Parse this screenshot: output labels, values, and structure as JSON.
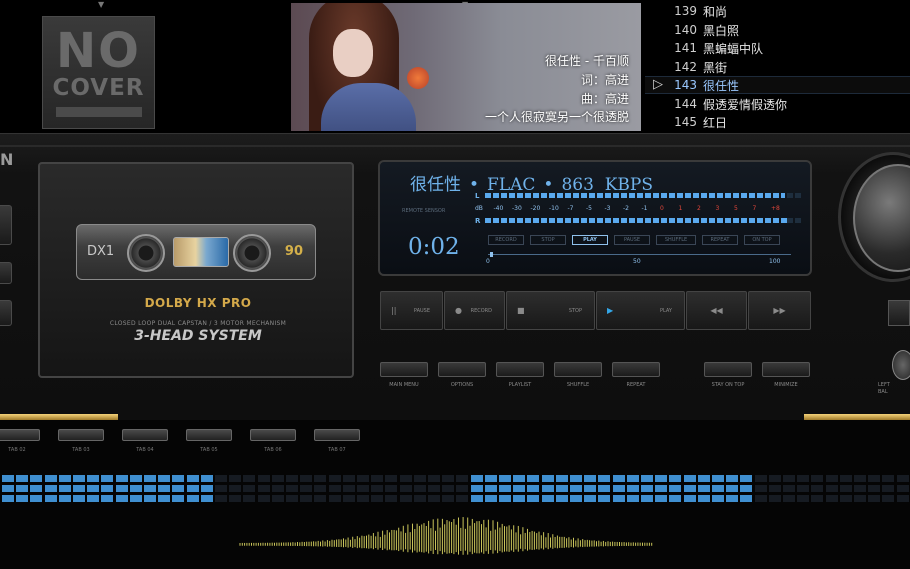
{
  "top": {
    "no_cover": {
      "line1": "NO",
      "line2": "COVER"
    },
    "lyrics": [
      "很任性 - 千百顺",
      "词：高进",
      "曲：高进",
      "一个人很寂寞另一个很透脱"
    ]
  },
  "playlist": {
    "items": [
      {
        "num": "139",
        "title": "和尚"
      },
      {
        "num": "140",
        "title": "黑白照"
      },
      {
        "num": "141",
        "title": "黑蝙蝠中队"
      },
      {
        "num": "142",
        "title": "黑街"
      },
      {
        "num": "143",
        "title": "很任性",
        "selected": true
      },
      {
        "num": "144",
        "title": "假透爱情假透你"
      },
      {
        "num": "145",
        "title": "红日"
      }
    ],
    "current_marker": "▷"
  },
  "deck": {
    "brand": "N",
    "cassette": {
      "label": "DX1",
      "type": "90"
    },
    "dolby": "DOLBY HX PRO",
    "mechanism": "CLOSED LOOP  DUAL CAPSTAN / 3 MOTOR MECHANISM",
    "system": "3-HEAD SYSTEM"
  },
  "display": {
    "track": "很任性",
    "format": "FLAC",
    "bitrate": "863",
    "unit": "KBPS",
    "remote_sensor": "REMOTE SENSOR",
    "time": "0:02",
    "channel_l": "L",
    "channel_r": "R",
    "scale": [
      "dB",
      "-40",
      "-30",
      "-20",
      "-10",
      "-7",
      "-5",
      "-3",
      "-2",
      "-1",
      "0",
      "1",
      "2",
      "3",
      "5",
      "7",
      "+8"
    ],
    "status_pills": [
      "RECORD",
      "STOP",
      "PLAY",
      "PAUSE",
      "SHUFFLE",
      "REPEAT",
      "ON TOP"
    ],
    "active_pill": "PLAY",
    "progress_labels": [
      "0",
      "50",
      "100"
    ],
    "progress": 0.01
  },
  "transport": [
    {
      "icon": "||",
      "label": "PAUSE"
    },
    {
      "icon": "●",
      "label": "RECORD"
    },
    {
      "icon": "■",
      "label": "STOP"
    },
    {
      "icon": "▶",
      "label": "PLAY"
    },
    {
      "icon": "◀◀",
      "label": ""
    },
    {
      "icon": "▶▶",
      "label": ""
    }
  ],
  "small_buttons": [
    "MAIN MENU",
    "OPTIONS",
    "PLAYLIST",
    "SHUFFLE",
    "REPEAT",
    "STAY ON TOP",
    "MINIMIZE"
  ],
  "balance_label": [
    "LEFT",
    "BAL"
  ],
  "tabs": [
    "TAB 02",
    "TAB 03",
    "TAB 04",
    "TAB 05",
    "TAB 06",
    "TAB 07"
  ],
  "colors": {
    "accent": "#6fb2ea",
    "gold": "#d4a94a",
    "eq_on": "#3f8fd0",
    "wave": "#c9c45a"
  }
}
